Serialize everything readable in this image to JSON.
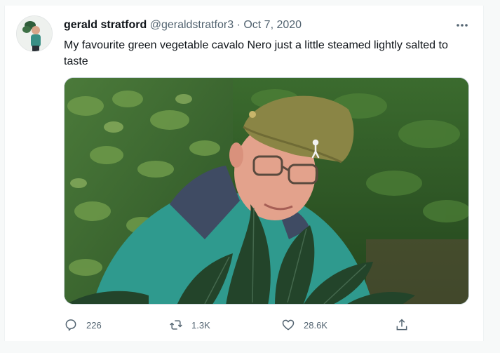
{
  "tweet": {
    "display_name": "gerald stratford",
    "handle": "@geraldstratfor3",
    "separator": "·",
    "date": "Oct 7, 2020",
    "text": "My favourite green vegetable cavalo Nero just a little steamed lightly salted to taste",
    "more_icon": "more-horizontal-icon",
    "actions": {
      "reply_count": "226",
      "retweet_count": "1.3K",
      "like_count": "28.6K"
    },
    "icons": {
      "reply": "reply-icon",
      "retweet": "retweet-icon",
      "like": "heart-icon",
      "share": "share-icon"
    }
  },
  "colors": {
    "secondary_text": "#536471",
    "primary_text": "#0f1419",
    "border": "#cfd9de"
  }
}
